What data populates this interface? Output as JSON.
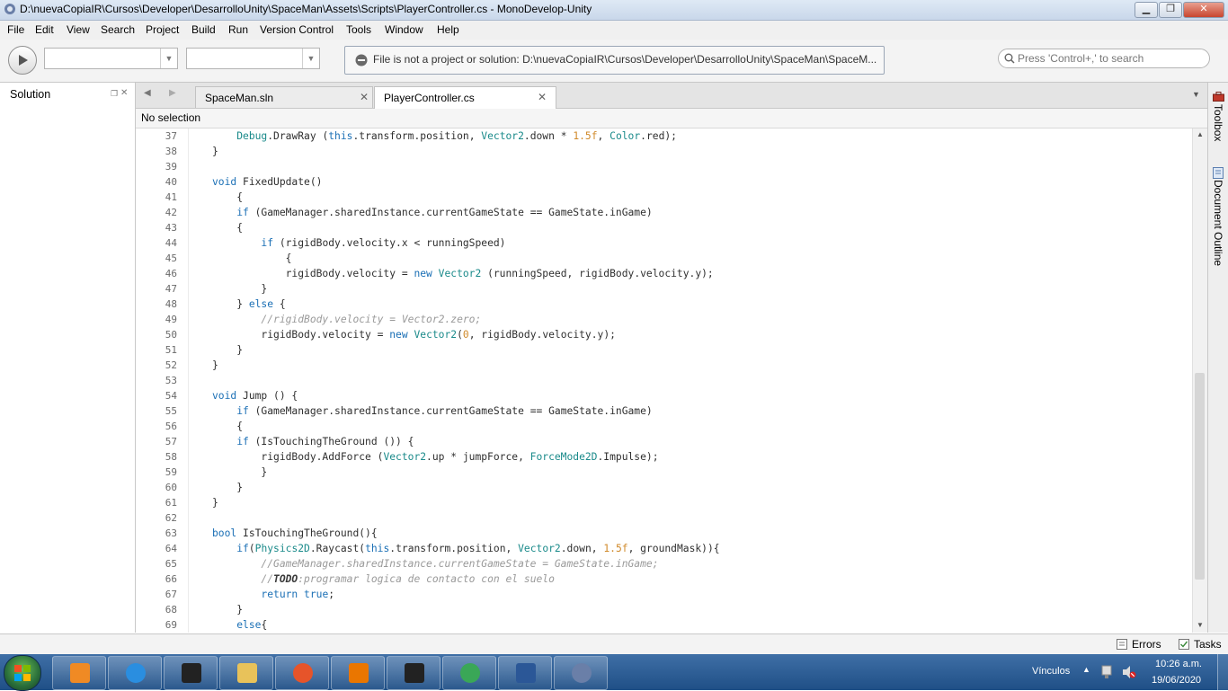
{
  "window": {
    "title": "D:\\nuevaCopiaIR\\Cursos\\Developer\\DesarrolloUnity\\SpaceMan\\Assets\\Scripts\\PlayerController.cs - MonoDevelop-Unity",
    "icon": "monodevelop-icon",
    "controls": {
      "minimize": "▁",
      "maximize": "❐",
      "close": "✕"
    }
  },
  "menu": [
    "File",
    "Edit",
    "View",
    "Search",
    "Project",
    "Build",
    "Run",
    "Version Control",
    "Tools",
    "Window",
    "Help"
  ],
  "toolbar": {
    "run_icon": "play-icon",
    "config_value": "",
    "platform_value": "",
    "status_message": "File is not a project or solution: D:\\nuevaCopiaIR\\Cursos\\Developer\\DesarrolloUnity\\SpaceMan\\SpaceM...",
    "search_placeholder": "Press 'Control+,' to search"
  },
  "solution_pane": {
    "title": "Solution",
    "buttons": [
      "❐",
      "✕"
    ]
  },
  "tabs": [
    {
      "label": "SpaceMan.sln",
      "active": false
    },
    {
      "label": "PlayerController.cs",
      "active": true
    }
  ],
  "nav": {
    "back": "◀",
    "forward": "▶",
    "dropdown": "▼"
  },
  "path_bar": "No selection",
  "code_lines": [
    {
      "n": "37",
      "text": "    Debug.DrawRay (this.transform.position, Vector2.down * 1.5f, Color.red);"
    },
    {
      "n": "38",
      "text": "}"
    },
    {
      "n": "39",
      "text": ""
    },
    {
      "n": "40",
      "text": "void FixedUpdate()"
    },
    {
      "n": "41",
      "text": "    {"
    },
    {
      "n": "42",
      "text": "    if (GameManager.sharedInstance.currentGameState == GameState.inGame)"
    },
    {
      "n": "43",
      "text": "    {"
    },
    {
      "n": "44",
      "text": "        if (rigidBody.velocity.x < runningSpeed)"
    },
    {
      "n": "45",
      "text": "            {"
    },
    {
      "n": "46",
      "text": "            rigidBody.velocity = new Vector2 (runningSpeed, rigidBody.velocity.y);"
    },
    {
      "n": "47",
      "text": "        }"
    },
    {
      "n": "48",
      "text": "    } else {"
    },
    {
      "n": "49",
      "text": "        //rigidBody.velocity = Vector2.zero;"
    },
    {
      "n": "50",
      "text": "        rigidBody.velocity = new Vector2(0, rigidBody.velocity.y);"
    },
    {
      "n": "51",
      "text": "    }"
    },
    {
      "n": "52",
      "text": "}"
    },
    {
      "n": "53",
      "text": ""
    },
    {
      "n": "54",
      "text": "void Jump () {"
    },
    {
      "n": "55",
      "text": "    if (GameManager.sharedInstance.currentGameState == GameState.inGame)"
    },
    {
      "n": "56",
      "text": "    {"
    },
    {
      "n": "57",
      "text": "    if (IsTouchingTheGround ()) {"
    },
    {
      "n": "58",
      "text": "        rigidBody.AddForce (Vector2.up * jumpForce, ForceMode2D.Impulse);"
    },
    {
      "n": "59",
      "text": "        }"
    },
    {
      "n": "60",
      "text": "    }"
    },
    {
      "n": "61",
      "text": "}"
    },
    {
      "n": "62",
      "text": ""
    },
    {
      "n": "63",
      "text": "bool IsTouchingTheGround(){"
    },
    {
      "n": "64",
      "text": "    if(Physics2D.Raycast(this.transform.position, Vector2.down, 1.5f, groundMask)){"
    },
    {
      "n": "65",
      "text": "        //GameManager.sharedInstance.currentGameState = GameState.inGame;"
    },
    {
      "n": "66",
      "text": "        //TODO:programar logica de contacto con el suelo"
    },
    {
      "n": "67",
      "text": "        return true;"
    },
    {
      "n": "68",
      "text": "    }"
    },
    {
      "n": "69",
      "text": "    else{"
    }
  ],
  "right_dock": {
    "toolbox": "Toolbox",
    "document_outline": "Document Outline"
  },
  "bottom_bar": {
    "errors": "Errors",
    "tasks": "Tasks"
  },
  "taskbar": {
    "apps": [
      {
        "name": "media-player-icon",
        "color": "#f08a24"
      },
      {
        "name": "internet-explorer-icon",
        "color": "#2a8ee0"
      },
      {
        "name": "unity-icon",
        "color": "#222222"
      },
      {
        "name": "file-explorer-icon",
        "color": "#e8c25a"
      },
      {
        "name": "firefox-icon",
        "color": "#e6542a"
      },
      {
        "name": "blender-icon",
        "color": "#ea7600"
      },
      {
        "name": "unity-icon",
        "color": "#222222"
      },
      {
        "name": "chrome-icon",
        "color": "#3aa757"
      },
      {
        "name": "word-icon",
        "color": "#2b5797"
      },
      {
        "name": "monodevelop-icon",
        "color": "#6a7fa8"
      }
    ],
    "tray_label": "Vínculos",
    "time": "10:26 a.m.",
    "date": "19/06/2020"
  },
  "colors": {
    "keyword": "#1a6fb5",
    "type": "#1a8a8a",
    "number": "#d08a2b",
    "comment": "#9a9a9a"
  }
}
